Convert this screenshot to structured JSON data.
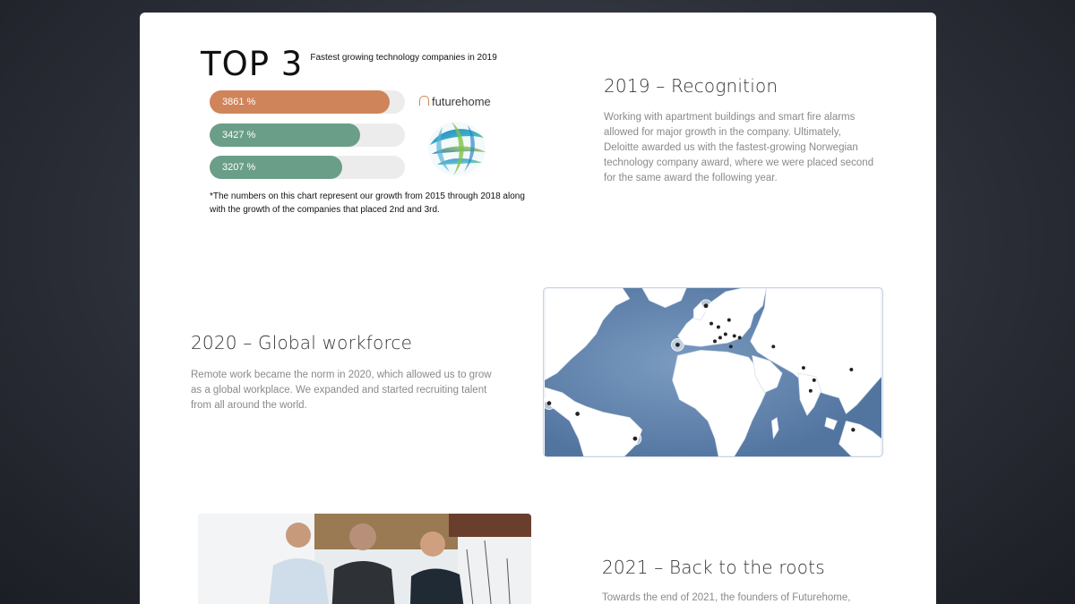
{
  "chart": {
    "big_title": "TOP 3",
    "subtitle": "Fastest growing technology companies in 2019",
    "note": "*The numbers on this chart represent our growth from 2015 through 2018 along with the growth of the companies that placed 2nd and 3rd.",
    "bars": [
      {
        "label": "3861 %",
        "fraction": 0.92,
        "color": "#d0845a"
      },
      {
        "label": "3427 %",
        "fraction": 0.77,
        "color": "#6b9e88"
      },
      {
        "label": "3207 %",
        "fraction": 0.68,
        "color": "#6b9e88"
      }
    ],
    "brand_logo_text": "futurehome"
  },
  "section_2019": {
    "heading": "2019 – Recognition",
    "body": "Working with apartment buildings and smart fire alarms allowed for major growth in the company. Ultimately, Deloitte awarded us with the fastest-growing Norwegian technology company award, where we were placed second for the same award the following year."
  },
  "section_2020": {
    "heading": "2020 – Global workforce",
    "body": "Remote work became the norm in 2020, which allowed us to grow as a global workplace. We expanded and started recruiting talent from all around the world."
  },
  "section_2021": {
    "heading": "2021 – Back to the roots",
    "body": "Towards the end of 2021, the founders of Futurehome,"
  },
  "colors": {
    "ocean": "#5b7fa6",
    "land": "#ffffff",
    "bar_orange": "#d0845a",
    "bar_green": "#6b9e88"
  }
}
